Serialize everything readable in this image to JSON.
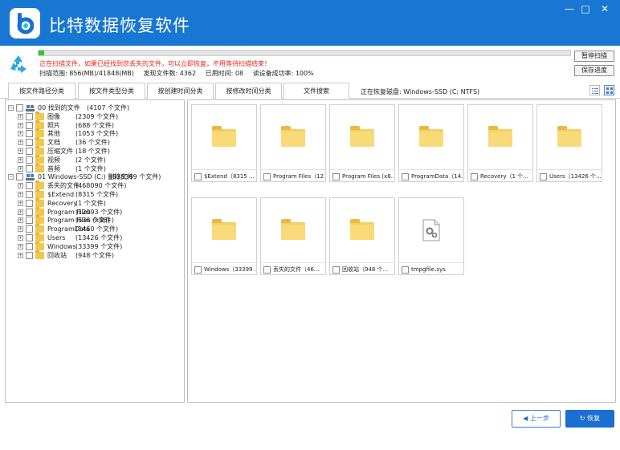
{
  "app": {
    "title": "比特数据恢复软件",
    "window_controls": {
      "minimize": "—",
      "maximize": "□",
      "close": "✕"
    }
  },
  "scan": {
    "progress_fraction": 0.01,
    "message": "正在扫描文件，如果已经找到您丢失的文件，可以立即恢复，不用等待扫描结束！",
    "stats": {
      "range": "扫描范围: 856(MB)/41848(MB)",
      "found": "发现文件数: 4362",
      "elapsed": "已用时间: 08",
      "read_rate": "读设备成功率: 100%"
    },
    "pause_label": "暂停扫描",
    "save_label": "保存进度"
  },
  "tabs": [
    "按文件路径分类",
    "按文件类型分类",
    "按创建时间分类",
    "按修改时间分类",
    "文件搜索"
  ],
  "active_tab": 0,
  "current_disk": "正在恢复磁盘: Windows-SSD (C: NTFS)",
  "view_modes": {
    "list": "list-view-icon",
    "grid": "grid-view-icon",
    "selected": "grid"
  },
  "tree": [
    {
      "depth": 0,
      "icon": "drive-icon",
      "name": "00 找到的文件",
      "count": "(4107 个文件)"
    },
    {
      "depth": 1,
      "icon": "folder-icon",
      "name": "图像",
      "count": "(2309 个文件)"
    },
    {
      "depth": 1,
      "icon": "folder-icon",
      "name": "照片",
      "count": "(688 个文件)"
    },
    {
      "depth": 1,
      "icon": "folder-icon",
      "name": "其他",
      "count": "(1053 个文件)"
    },
    {
      "depth": 1,
      "icon": "folder-icon",
      "name": "文档",
      "count": "(36 个文件)"
    },
    {
      "depth": 1,
      "icon": "folder-icon",
      "name": "压缩文件",
      "count": "(18 个文件)"
    },
    {
      "depth": 1,
      "icon": "folder-icon",
      "name": "视频",
      "count": "(2 个文件)"
    },
    {
      "depth": 1,
      "icon": "folder-icon",
      "name": "音频",
      "count": "(1 个文件)"
    },
    {
      "depth": 0,
      "icon": "drive-icon",
      "name": "01 Windows-SSD (C:) 删除文件",
      "count": "(538369 个文件)"
    },
    {
      "depth": 1,
      "icon": "folder-icon",
      "name": "丢失的文件",
      "count": "(468090 个文件)"
    },
    {
      "depth": 1,
      "icon": "folder-icon",
      "name": "$Extend",
      "count": "(8315 个文件)"
    },
    {
      "depth": 1,
      "icon": "folder-icon",
      "name": "Recovery",
      "count": "(1 个文件)"
    },
    {
      "depth": 1,
      "icon": "folder-icon",
      "name": "Program Files",
      "count": "(12093 个文件)"
    },
    {
      "depth": 1,
      "icon": "folder-icon",
      "name": "Program Files (x86)",
      "count": "(636 个文件)"
    },
    {
      "depth": 1,
      "icon": "folder-icon",
      "name": "ProgramData",
      "count": "(1460 个文件)"
    },
    {
      "depth": 1,
      "icon": "folder-icon",
      "name": "Users",
      "count": "(13426 个文件)"
    },
    {
      "depth": 1,
      "icon": "folder-icon",
      "name": "Windows",
      "count": "(33399 个文件)"
    },
    {
      "depth": 1,
      "icon": "folder-icon",
      "name": "回收站",
      "count": "(948 个文件)"
    }
  ],
  "grid_items": [
    {
      "icon": "folder-icon",
      "label": "$Extend（8315 ..."
    },
    {
      "icon": "folder-icon",
      "label": "Program Files（12..."
    },
    {
      "icon": "folder-icon",
      "label": "Program Files (x8..."
    },
    {
      "icon": "folder-icon",
      "label": "ProgramData（14..."
    },
    {
      "icon": "folder-icon",
      "label": "Recovery（1 个..."
    },
    {
      "icon": "folder-icon",
      "label": "Users（13426 个..."
    },
    {
      "icon": "folder-icon",
      "label": "Windows（33399 ..."
    },
    {
      "icon": "folder-icon",
      "label": "丢失的文件（46..."
    },
    {
      "icon": "folder-icon",
      "label": "回收站（948 个..."
    },
    {
      "icon": "system-file-icon",
      "label": "tmpgfile.sys"
    }
  ],
  "buttons": {
    "prev": "上一步",
    "recover": "恢复"
  },
  "colors": {
    "titlebar": "#1877d2",
    "accent": "#1b6fd0",
    "progress": "#2ec72e",
    "warning_text": "#e8231a",
    "folder": "#f6cf62"
  }
}
